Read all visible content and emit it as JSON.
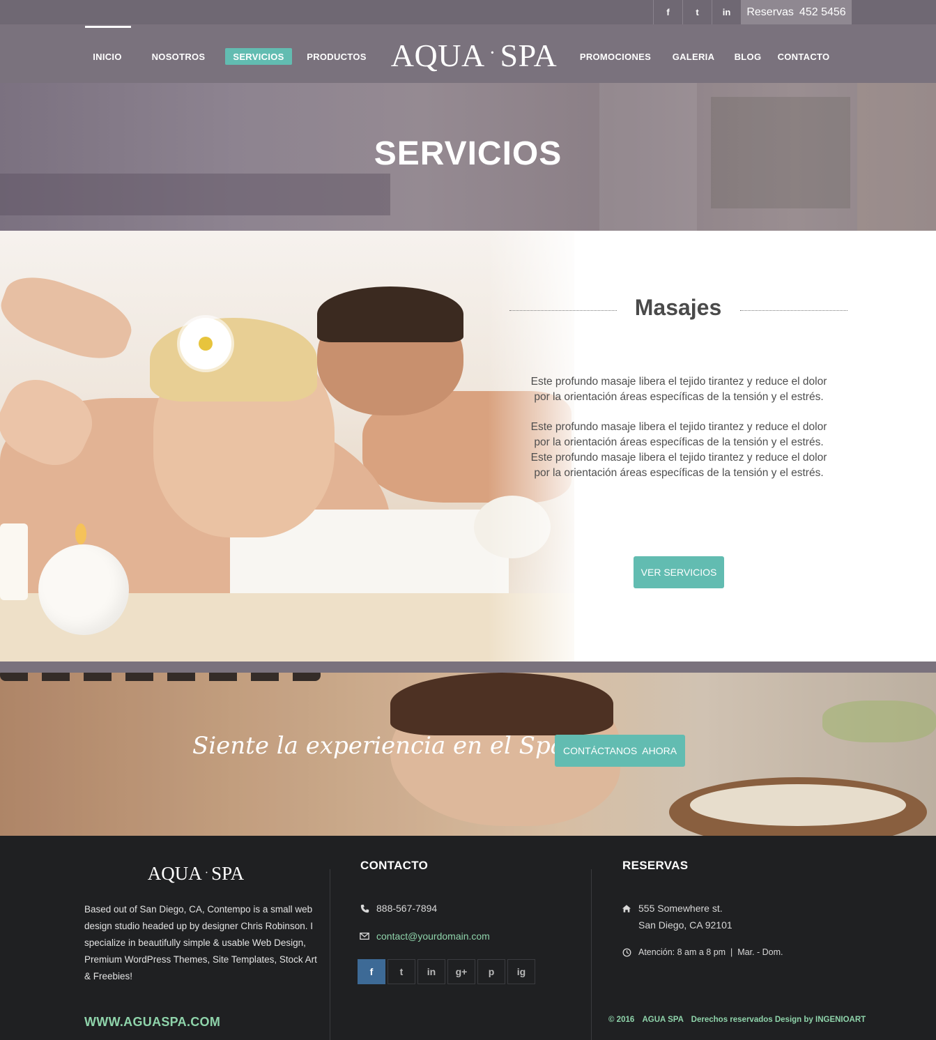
{
  "topbar": {
    "social": [
      "f",
      "t",
      "in"
    ],
    "reserve_label": "Reservas",
    "reserve_phone": "452 5456"
  },
  "nav": {
    "left": [
      {
        "label": "INICIO",
        "active": false
      },
      {
        "label": "NOSOTROS",
        "active": false
      },
      {
        "label": "SERVICIOS",
        "active": true
      },
      {
        "label": "PRODUCTOS",
        "active": false
      }
    ],
    "right": [
      {
        "label": "PROMOCIONES",
        "active": false
      },
      {
        "label": "GALERIA",
        "active": false
      },
      {
        "label": "BLOG",
        "active": false
      },
      {
        "label": "CONTACTO",
        "active": false
      }
    ],
    "logo_left": "AQUA",
    "logo_dot": "·",
    "logo_right": "SPA",
    "active_color": "#62bcb1"
  },
  "hero": {
    "title": "SERVICIOS"
  },
  "masajes": {
    "title": "Masajes",
    "paragraph1": "Este profundo masaje libera el tejido tirantez y reduce el dolor por la orientación áreas específicas de la tensión y el estrés.",
    "paragraph2": "Este profundo masaje libera el tejido tirantez y reduce el dolor por la orientación áreas específicas de la tensión y el estrés. Este profundo masaje libera el tejido tirantez y reduce el dolor por la orientación áreas específicas de la tensión y el estrés.",
    "button": "VER SERVICIOS"
  },
  "banner": {
    "tagline": "Siente la experiencia en el Spa",
    "button": "CONTÁCTANOS  AHORA"
  },
  "footer": {
    "logo_left": "AQUA",
    "logo_dot": "·",
    "logo_right": "SPA",
    "about": "Based out of San Diego, CA, Contempo is a small web design studio headed up by designer Chris Robinson. I specialize in beautifully simple & usable Web Design, Premium WordPress Themes, Site Templates, Stock Art & Freebies!",
    "website": "WWW.AGUASPA.COM",
    "contacto": {
      "title": "CONTACTO",
      "phone": "888-567-7894",
      "email": "contact@yourdomain.com",
      "social": [
        "f",
        "t",
        "in",
        "g+",
        "p",
        "ig"
      ]
    },
    "reservas": {
      "title": "RESERVAS",
      "address1": "555 Somewhere st.",
      "address2": "San Diego, CA 92101",
      "hours": "Atención: 8 am a 8 pm  |  Mar. - Dom."
    },
    "copyright": {
      "year": "© 2016",
      "brand": "AGUA SPA",
      "rights": "Derechos reservados Design by INGENIOART"
    }
  }
}
